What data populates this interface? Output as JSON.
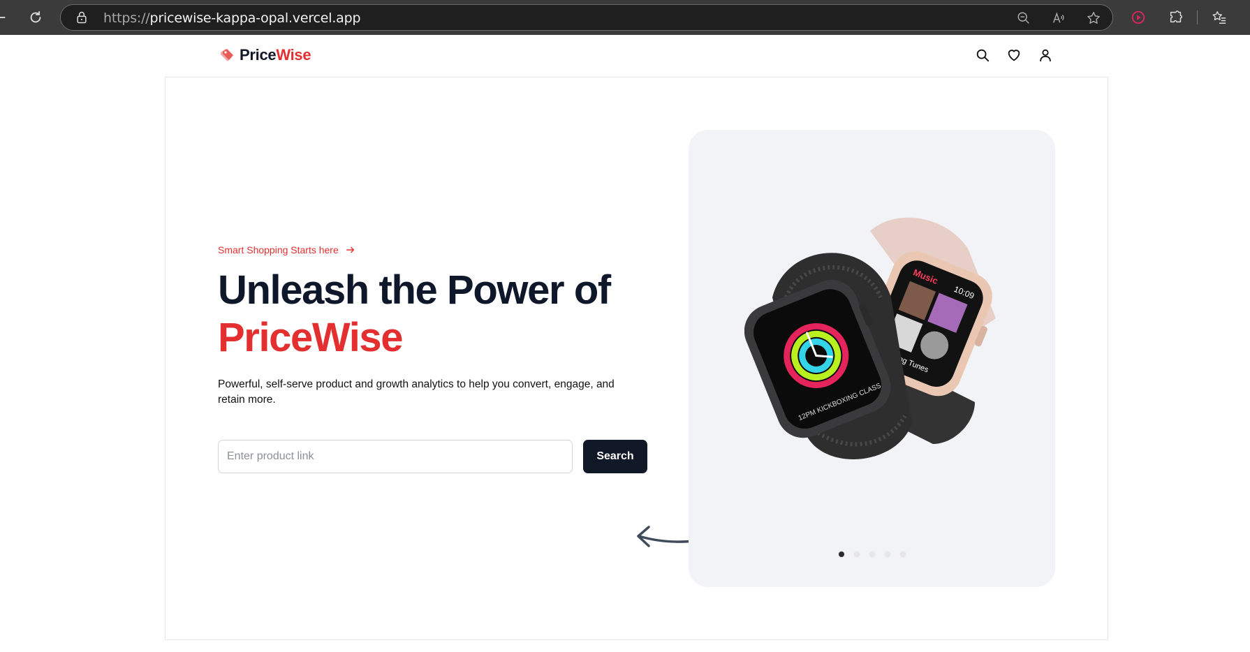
{
  "browser": {
    "url_protocol": "https://",
    "url_host": "pricewise-kappa-opal.vercel.app",
    "icons": [
      "back-icon",
      "refresh-icon",
      "lock-icon",
      "zoom-out-icon",
      "read-aloud-icon",
      "favorite-star-icon",
      "media-icon",
      "extensions-icon",
      "favorites-list-icon"
    ]
  },
  "nav": {
    "brand_prefix": "Price",
    "brand_accent": "Wise",
    "icons": [
      "search-icon",
      "heart-icon",
      "user-icon"
    ]
  },
  "hero": {
    "tagline": "Smart Shopping Starts here",
    "headline_line1": "Unleash the Power of",
    "headline_brand": "PriceWise",
    "description": "Powerful, self-serve product and growth analytics to help you convert, engage, and retain more.",
    "search_placeholder": "Enter product link",
    "search_button": "Search"
  },
  "carousel": {
    "slide_count": 5,
    "active_index": 0,
    "watch_screen_left": "12PM KICKBOXING CLASS",
    "watch_screen_right_title": "Music",
    "watch_screen_right_time": "10:09",
    "watch_screen_right_label": "Running Tunes"
  },
  "colors": {
    "accent": "#e32f2f",
    "dark": "#111827",
    "carousel_bg": "#f2f3f6"
  }
}
